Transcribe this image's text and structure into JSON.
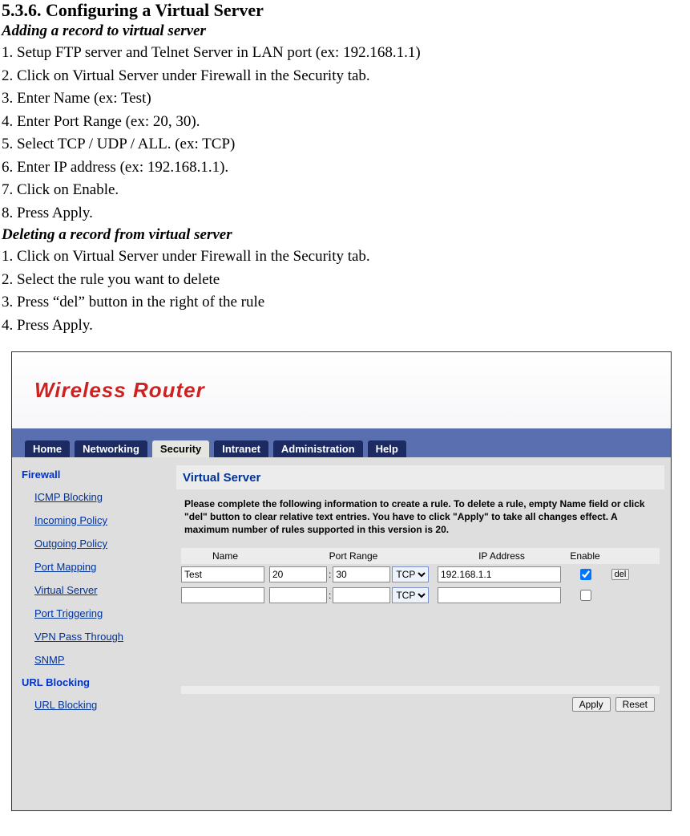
{
  "doc": {
    "section_title": "5.3.6. Configuring a Virtual Server",
    "subhead_add": "Adding a record to virtual server",
    "add_steps": [
      "1. Setup FTP server and Telnet Server in LAN port (ex: 192.168.1.1)",
      "2. Click on Virtual Server under Firewall in the Security tab.",
      "3. Enter Name (ex: Test)",
      "4. Enter Port Range (ex: 20, 30).",
      "5. Select TCP / UDP / ALL. (ex: TCP)",
      "6. Enter IP address (ex: 192.168.1.1).",
      "7. Click on Enable.",
      "8. Press Apply."
    ],
    "subhead_del": "Deleting a record from virtual server",
    "del_steps": [
      "1. Click on Virtual Server under Firewall in the Security tab.",
      "2. Select the rule you want to delete",
      "3. Press “del” button in the right of the rule",
      "4. Press Apply."
    ]
  },
  "router": {
    "logo_text": "Wireless Router",
    "tabs": {
      "home": "Home",
      "networking": "Networking",
      "security": "Security",
      "intranet": "Intranet",
      "administration": "Administration",
      "help": "Help"
    },
    "sidebar": {
      "group1_title": "Firewall",
      "group1_links": [
        "ICMP Blocking",
        "Incoming Policy",
        "Outgoing Policy",
        "Port Mapping",
        "Virtual Server",
        "Port Triggering",
        "VPN Pass Through",
        "SNMP"
      ],
      "group2_title": "URL Blocking",
      "group2_links": [
        "URL Blocking"
      ]
    },
    "panel": {
      "title": "Virtual Server",
      "desc": "Please complete the following information to create a rule. To delete a rule, empty Name field or click \"del\" button to clear relative text entries. You have to click \"Apply\" to take all changes effect. A maximum number of rules supported in this version is 20.",
      "headers": {
        "name": "Name",
        "port_range": "Port Range",
        "ip": "IP Address",
        "enable": "Enable"
      },
      "rows": [
        {
          "name": "Test",
          "p1": "20",
          "p2": "30",
          "proto": "TCP",
          "ip": "192.168.1.1",
          "enabled": true,
          "del_label": "del"
        },
        {
          "name": "",
          "p1": "",
          "p2": "",
          "proto": "TCP",
          "ip": "",
          "enabled": false,
          "del_label": ""
        }
      ],
      "port_sep": ":",
      "buttons": {
        "apply": "Apply",
        "reset": "Reset"
      }
    }
  }
}
